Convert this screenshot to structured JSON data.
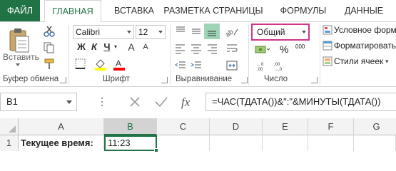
{
  "tabs": {
    "file": "ФАЙЛ",
    "home": "ГЛАВНАЯ",
    "insert": "ВСТАВКА",
    "layout": "РАЗМЕТКА СТРАНИЦЫ",
    "formulas": "ФОРМУЛЫ",
    "data": "ДАННЫЕ"
  },
  "ribbon": {
    "clipboard": {
      "paste_label": "Вставить",
      "group": "Буфер обмена"
    },
    "font": {
      "family": "Calibri",
      "size": "12",
      "bold": "Ж",
      "italic": "К",
      "underline": "Ч",
      "grow": "A",
      "shrink": "A",
      "group": "Шрифт"
    },
    "alignment": {
      "group": "Выравнивание"
    },
    "number": {
      "format": "Общий",
      "percent": "%",
      "thousands": "000",
      "inc_decimal": ",0 ,00",
      "group": "Число"
    },
    "styles": {
      "conditional": "Условное форма",
      "format_table": "Форматировать",
      "cell_styles": "Стили ячеек"
    }
  },
  "formula_bar": {
    "name_box": "B1",
    "formula": "=ЧАС(ТДАТА())&\":\"&МИНУТЫ(ТДАТА())"
  },
  "sheet": {
    "columns": [
      "A",
      "B",
      "C",
      "D",
      "E",
      "F",
      "G"
    ],
    "row_number": "1",
    "cells": {
      "A1": "Текущее время:",
      "B1": "11:23"
    }
  },
  "colors": {
    "accent": "#217346",
    "number_format_highlight": "#d1338e"
  },
  "icons": [
    "paste-icon",
    "cut-icon",
    "copy-icon",
    "format-painter-icon",
    "borders-icon",
    "fill-color-icon",
    "font-color-icon",
    "align-top-icon",
    "align-middle-icon",
    "align-bottom-icon",
    "align-left-icon",
    "align-center-icon",
    "align-right-icon",
    "orientation-icon",
    "wrap-text-icon",
    "merge-icon",
    "indent-decrease-icon",
    "indent-increase-icon",
    "currency-icon",
    "conditional-format-icon",
    "format-table-icon",
    "cell-styles-icon",
    "cancel-icon",
    "enter-icon",
    "fx-icon"
  ]
}
